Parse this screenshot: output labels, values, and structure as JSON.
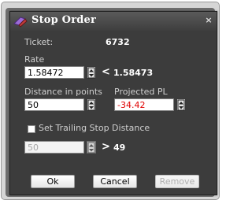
{
  "dialog": {
    "title": "Stop Order",
    "close_glyph": "×",
    "icons": {
      "app": "stop-order-icon",
      "close": "close-icon"
    }
  },
  "ticket": {
    "label": "Ticket:",
    "value": "6732"
  },
  "rate": {
    "label": "Rate",
    "input_value": "1.58472",
    "comparator": "<",
    "threshold": "1.58473"
  },
  "distance": {
    "label": "Distance in points",
    "input_value": "50"
  },
  "projected_pl": {
    "label": "Projected PL",
    "input_value": "-34.42"
  },
  "trailing_stop": {
    "checkbox_label": "Set Trailing Stop Distance",
    "checked": false,
    "input_value": "50",
    "comparator": ">",
    "threshold": "49"
  },
  "buttons": {
    "ok": "Ok",
    "cancel": "Cancel",
    "remove": "Remove"
  },
  "colors": {
    "dialog_bg": "#3c3c3c",
    "label": "#cfcfcf",
    "value": "#ffffff",
    "negative": "#e00000"
  }
}
